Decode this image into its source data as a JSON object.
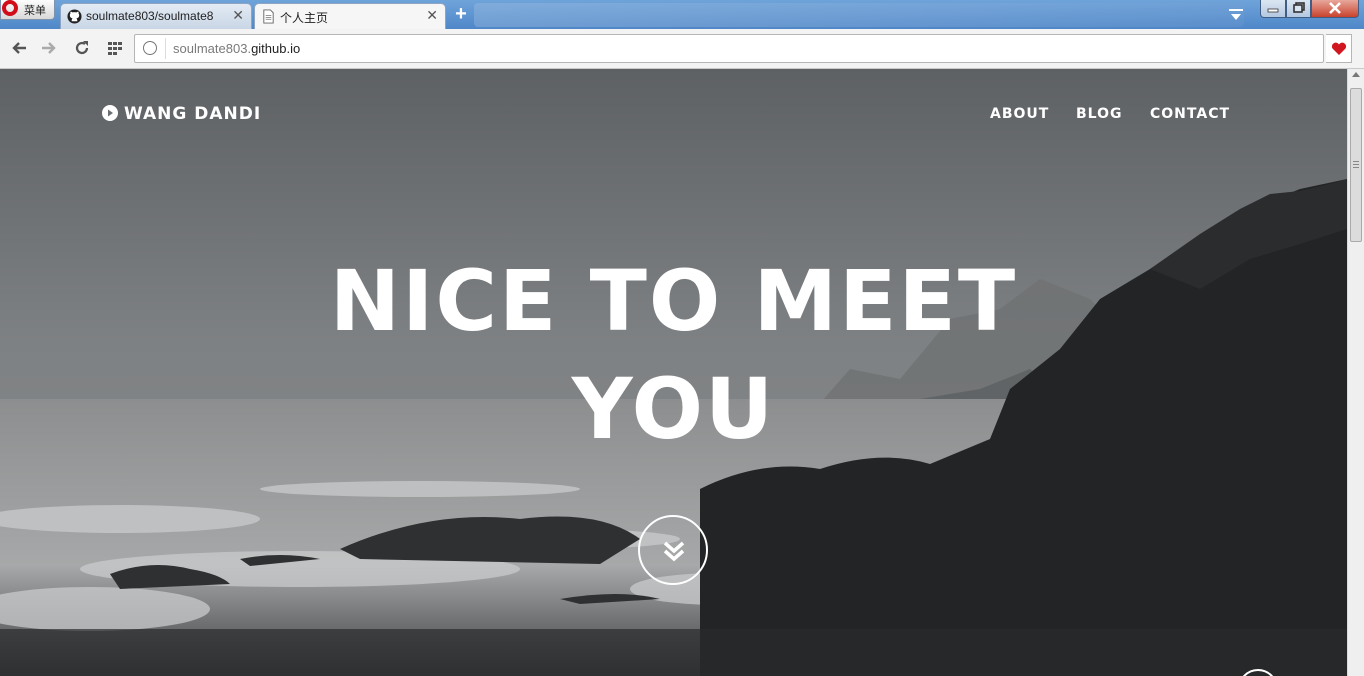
{
  "browser": {
    "menu_label": "菜单",
    "tabs": [
      {
        "title": "soulmate803/soulmate8",
        "icon": "github-icon"
      },
      {
        "title": "个人主页",
        "icon": "page-icon"
      }
    ],
    "address": {
      "url_prefix": "soulmate803.",
      "url_domain": "github.io"
    }
  },
  "site": {
    "brand": "WANG DANDI",
    "nav": [
      {
        "label": "ABOUT"
      },
      {
        "label": "BLOG"
      },
      {
        "label": "CONTACT"
      }
    ],
    "headline_line1": "NICE TO MEET",
    "headline_line2": "YOU"
  },
  "colors": {
    "chrome_blue": "#4f87c8",
    "hero_text": "#ffffff",
    "heart": "#d0161e"
  }
}
